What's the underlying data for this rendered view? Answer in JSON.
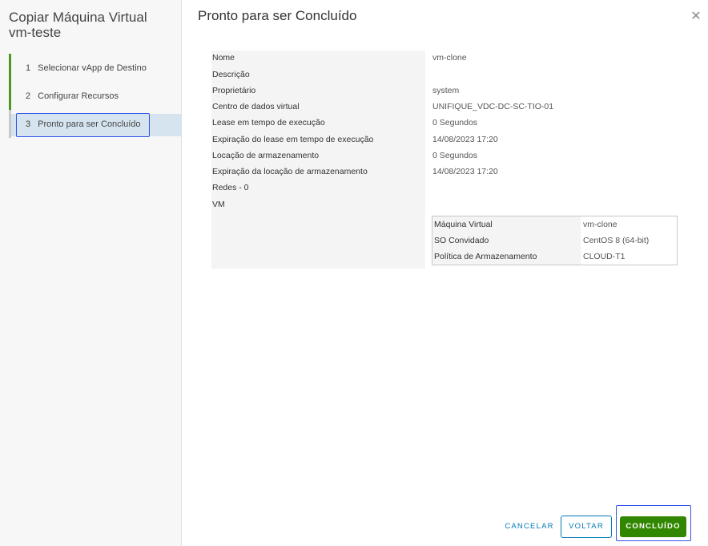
{
  "wizard": {
    "title": "Copiar Máquina Virtual vm-teste",
    "steps": [
      {
        "num": "1",
        "label": "Selecionar vApp de Destino"
      },
      {
        "num": "2",
        "label": "Configurar Recursos"
      },
      {
        "num": "3",
        "label": "Pronto para ser Concluído"
      }
    ]
  },
  "main": {
    "title": "Pronto para ser Concluído",
    "close_icon": "close-icon",
    "summary": [
      {
        "label": "Nome",
        "value": "vm-clone"
      },
      {
        "label": "Descrição",
        "value": ""
      },
      {
        "label": "Proprietário",
        "value": "system"
      },
      {
        "label": "Centro de dados virtual",
        "value": "UNIFIQUE_VDC-DC-SC-TIO-01"
      },
      {
        "label": "Lease em tempo de execução",
        "value": "0 Segundos"
      },
      {
        "label": "Expiração do lease em tempo de execução",
        "value": "14/08/2023 17:20"
      },
      {
        "label": "Locação de armazenamento",
        "value": "0 Segundos"
      },
      {
        "label": "Expiração da locação de armazenamento",
        "value": "14/08/2023 17:20"
      },
      {
        "label": "Redes - 0",
        "value": ""
      },
      {
        "label": "VM",
        "value": ""
      }
    ],
    "vm_table": [
      {
        "label": "Máquina Virtual",
        "value": "vm-clone"
      },
      {
        "label": "SO Convidado",
        "value": "CentOS 8 (64-bit)"
      },
      {
        "label": "Política de Armazenamento",
        "value": "CLOUD-T1"
      }
    ]
  },
  "footer": {
    "cancel_label": "CANCELAR",
    "back_label": "VOLTAR",
    "done_label": "CONCLUÍDO"
  },
  "colors": {
    "accent": "#0079b8",
    "primary_button": "#318700",
    "step_complete": "#4c9a1f",
    "active_step_bg": "#d6e4ef",
    "focus_outline": "#2f54eb"
  }
}
